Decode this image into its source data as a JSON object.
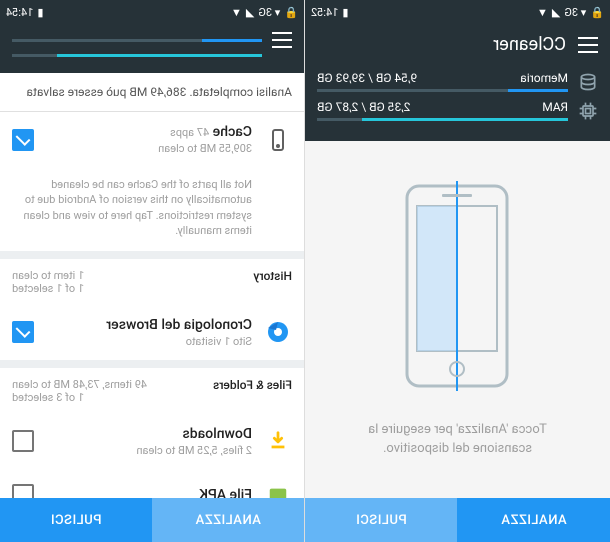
{
  "left": {
    "status": {
      "time": "14:52",
      "network": "3G"
    },
    "app_title": "CCleaner",
    "memory": {
      "label": "Memoria",
      "value": "9,54 GB / 39,93 GB",
      "percent": 24
    },
    "ram": {
      "label": "RAM",
      "value": "2,35 GB / 2,87 GB",
      "percent": 82
    },
    "hint": "Tocca 'Analizza' per eseguire la scansione del dispositivo.",
    "buttons": {
      "analyze": "ANALIZZA",
      "clean": "PULISCI"
    }
  },
  "right": {
    "status": {
      "time": "14:54",
      "network": "3G"
    },
    "analysis_result": "Analisi completata. 386,49 MB può essere salvata",
    "progress": {
      "blue_percent": 24,
      "teal_percent": 82
    },
    "cache": {
      "title": "Cache",
      "subtitle_apps": "47 apps",
      "subtitle_size": "309,55 MB to clean",
      "info": "Not all parts of the Cache can be cleaned automatically on this version of Android due to system restrictions. Tap here to view and clean items manually."
    },
    "history": {
      "section": "History",
      "meta_line1": "1 item to clean",
      "meta_line2": "1 of 1 selected",
      "item_title": "Cronologia del Browser",
      "item_subtitle": "Sito 1 visitato"
    },
    "files": {
      "section": "Files & Folders",
      "meta_line1": "49 items, 73,48 MB to clean",
      "meta_line2": "1 of 3 selected",
      "downloads_title": "Downloads",
      "downloads_subtitle": "2 files, 5,25 MB to clean",
      "apk_title": "File APK"
    },
    "buttons": {
      "analyze": "ANALIZZA",
      "clean": "PULISCI"
    }
  }
}
